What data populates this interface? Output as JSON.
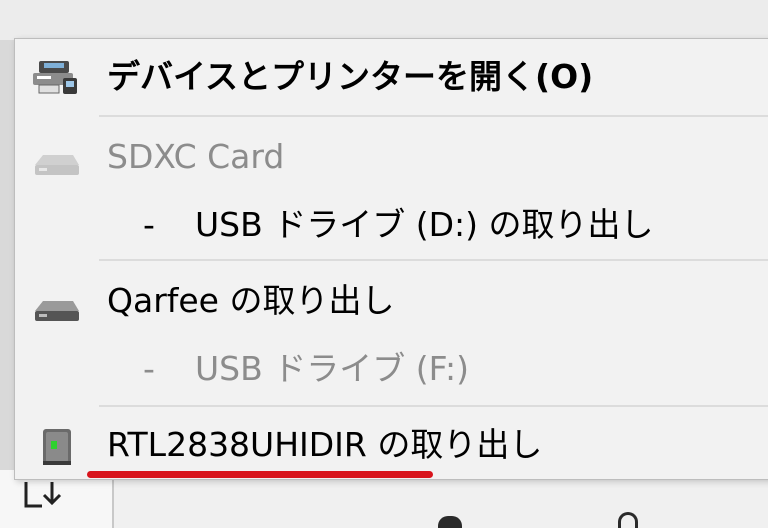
{
  "menu": {
    "items": [
      {
        "label": "デバイスとプリンターを開く(O)",
        "icon": "printer-device-icon",
        "enabled": true,
        "bold": true
      },
      {
        "label": "SDXC Card",
        "icon": "drive-icon",
        "enabled": false
      },
      {
        "label": "USB ドライブ (D:) の取り出し",
        "dash": "-",
        "enabled": true
      },
      {
        "label": "Qarfee の取り出し",
        "icon": "drive-icon",
        "enabled": true
      },
      {
        "label": "USB ドライブ (F:)",
        "dash": "-",
        "enabled": false
      },
      {
        "label": "RTL2838UHIDIR の取り出し",
        "icon": "usb-device-icon",
        "enabled": true
      }
    ]
  },
  "colors": {
    "highlight_underline": "#d8141c",
    "disabled_text": "#8c8c8c",
    "menu_bg": "#f2f2f2"
  }
}
